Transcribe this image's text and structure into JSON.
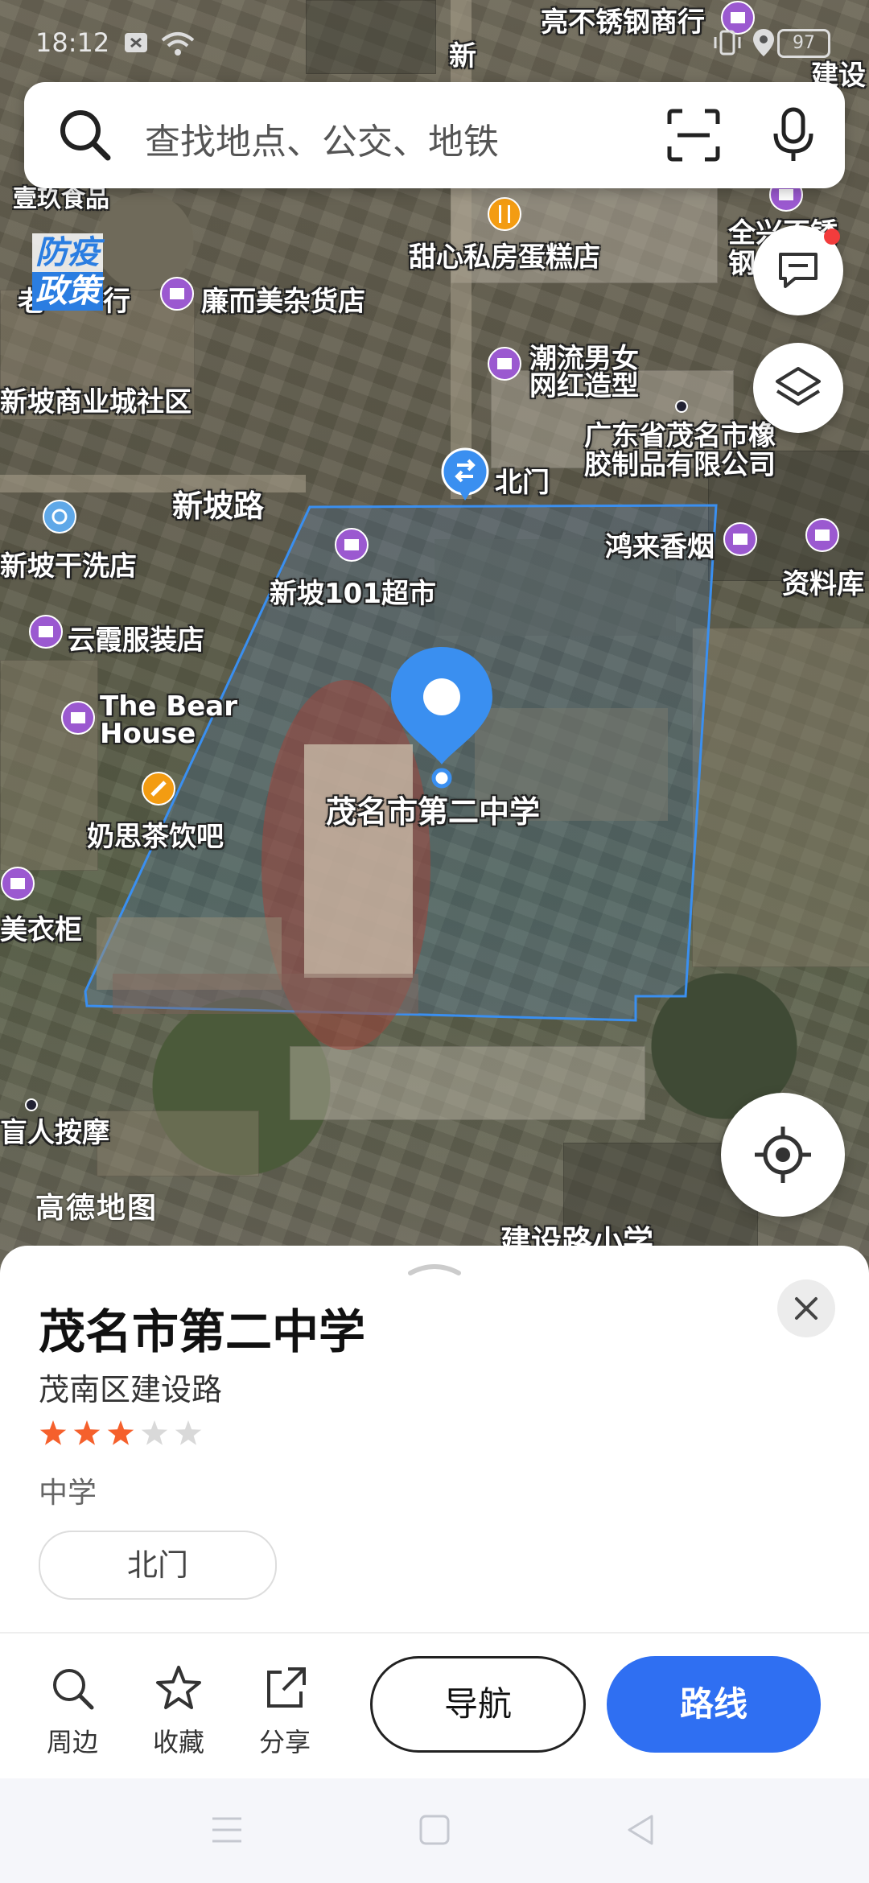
{
  "status_bar": {
    "time": "18:12",
    "battery": "97"
  },
  "search": {
    "placeholder": "查找地点、公交、地铁"
  },
  "map": {
    "badge_line1": "防疫",
    "badge_line2": "政策",
    "watermark": "高德地图",
    "selected_marker_label": "茂名市第二中学",
    "labels": {
      "l1": "亮不锈钢商行",
      "l2": "新",
      "l3": "建设",
      "l4": "壹玖食品",
      "l5": "甜心私房蛋糕店",
      "l6": "全兴不锈",
      "l7": "钢",
      "l8": "老",
      "l9": "行",
      "l10": "廉而美杂货店",
      "l11": "潮流男女",
      "l12": "网红造型",
      "l13": "新坡商业城社区",
      "l14": "广东省茂名市橡",
      "l15": "胶制品有限公司",
      "l16": "北门",
      "l17": "新坡路",
      "l18": "鸿来香烟",
      "l19": "资料库",
      "l20": "新坡101超市",
      "l21": "新坡干洗店",
      "l22": "云霞服装店",
      "l23": "The Bear",
      "l24": "House",
      "l25": "奶思茶饮吧",
      "l26": "美衣柜",
      "l27": "盲人按摩",
      "l28": "建设路小学"
    }
  },
  "place": {
    "name": "茂名市第二中学",
    "address": "茂南区建设路",
    "rating": 3,
    "rating_max": 5,
    "category": "中学",
    "gate": "北门"
  },
  "actions": {
    "nearby": "周边",
    "favorite": "收藏",
    "share": "分享",
    "navigate": "导航",
    "route": "路线"
  },
  "colors": {
    "accent": "#2f6ff2",
    "marker": "#3a8ff0",
    "star_on": "#f5602c",
    "star_off": "#d9d9d9",
    "poi_shop": "#9b59d0",
    "poi_food": "#f39c12"
  }
}
